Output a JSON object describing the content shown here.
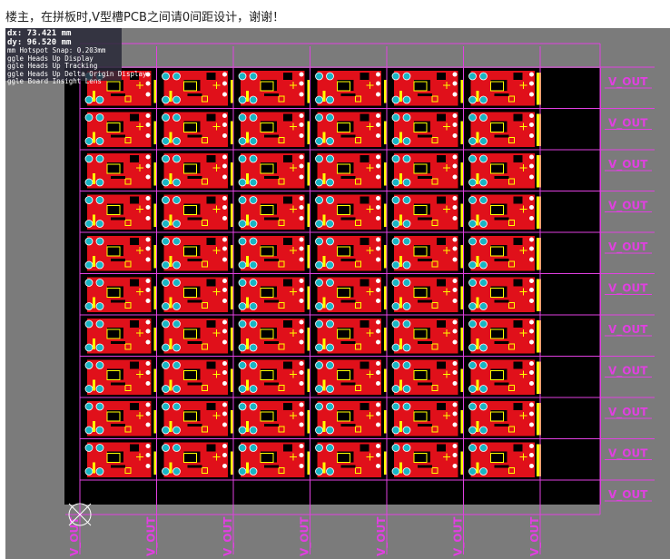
{
  "post": {
    "text": "楼主，在拼板时,V型槽PCB之间请0间距设计，谢谢！"
  },
  "hud": {
    "dx_text": "dx: 73.421 mm",
    "dy_text": "dy: 96.520 mm",
    "snap_text": "mm Hotspot Snap: 0.203mm",
    "items": [
      "ggle Heads Up Display",
      "ggle Heads Up Tracking",
      "ggle Heads Up Delta Origin Display",
      "ggle Board Insight Lens"
    ]
  },
  "vcut": {
    "label": "V_OUT",
    "right_label_count": 11,
    "bottom_label_count": 7
  },
  "panel": {
    "columns": 6,
    "rows": 10
  },
  "colors": {
    "background": "#7b7b7b",
    "board": "#000000",
    "copper_top": "#e0101a",
    "silkscreen": "#ffff00",
    "pad": "#19b5c4",
    "vcut_line": "#e040e0"
  }
}
